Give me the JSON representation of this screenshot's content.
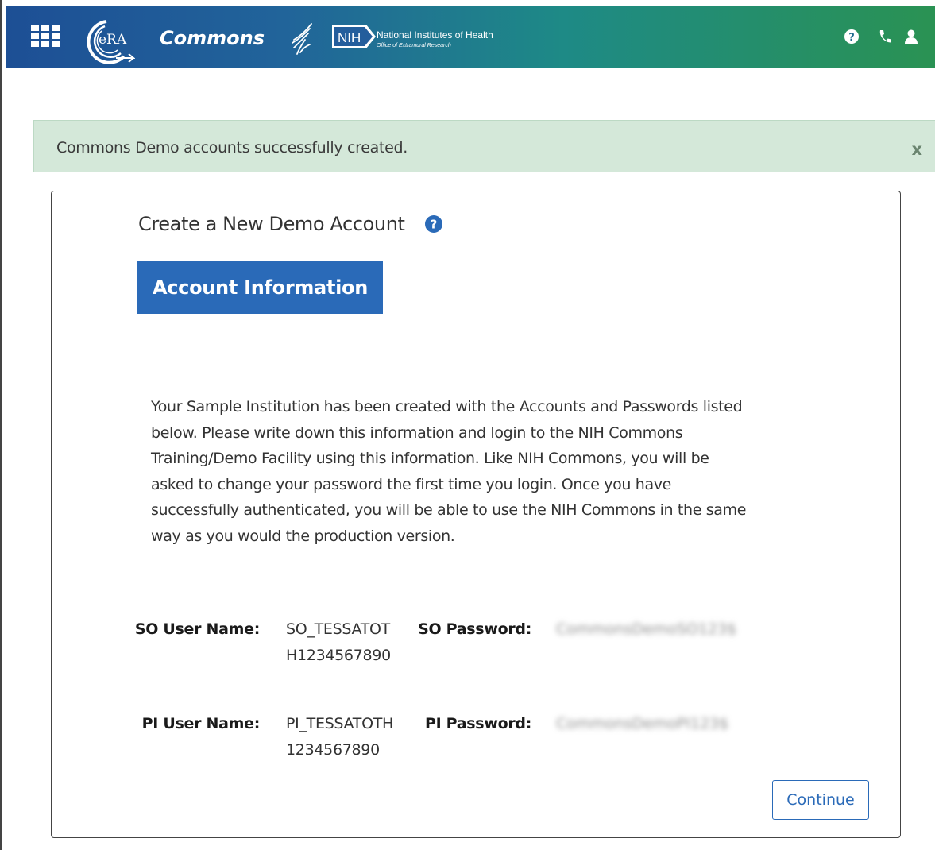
{
  "header": {
    "brand_name": "Commons",
    "era_logo_text": "eRA",
    "nih_logo_text": "NIH",
    "nih_name": "National Institutes of Health",
    "nih_sub": "Office of Extramural Research",
    "icons": [
      "grid-menu-icon",
      "help-icon",
      "phone-icon",
      "user-icon"
    ],
    "colors": {
      "gradient_start": "#1d4f95",
      "gradient_end": "#2a9253"
    }
  },
  "alert": {
    "message": "Commons Demo accounts successfully created.",
    "close_label": "x",
    "color": "#d4e8d9"
  },
  "card": {
    "title": "Create a New Demo Account",
    "section_label": "Account Information",
    "paragraph": "Your Sample Institution has been created with the Accounts and Passwords listed below. Please write down this information and login to the NIH Commons Training/Demo Facility using this information. Like NIH Commons, you will be asked to change your password the first time you login. Once you have successfully authenticated, you will be able to use the NIH Commons in the same way as you would the production version.",
    "credentials": {
      "so_user_label": "SO User Name:",
      "so_user_value": "SO_TESSATOTH1234567890",
      "so_password_label": "SO Password:",
      "so_password_value": "CommonsDemoSO123$",
      "pi_user_label": "PI User Name:",
      "pi_user_value": "PI_TESSATOTH1234567890",
      "pi_password_label": "PI Password:",
      "pi_password_value": "CommonsDemoPI123$"
    },
    "continue_label": "Continue"
  }
}
